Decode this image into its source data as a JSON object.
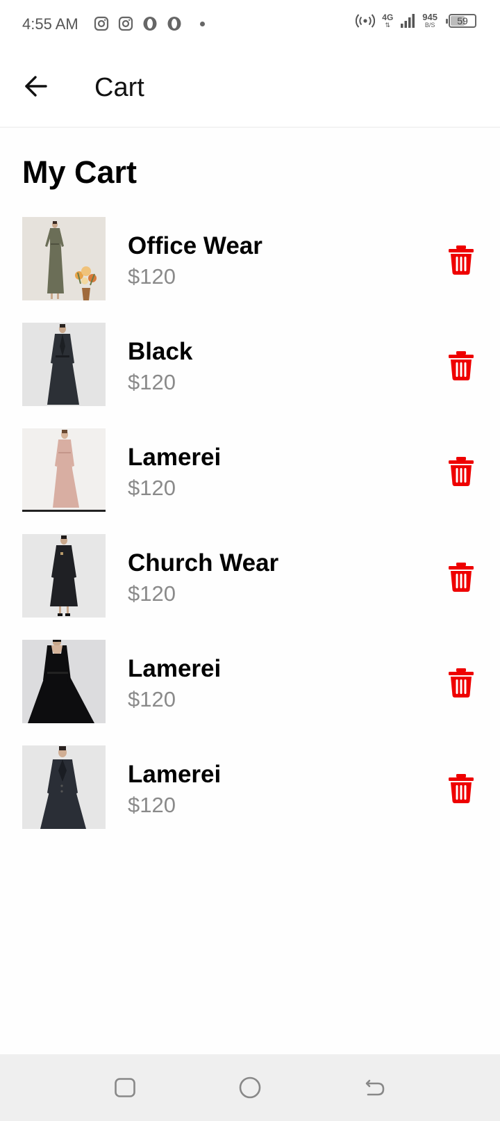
{
  "status_bar": {
    "time": "4:55 AM",
    "network_type": "4G",
    "network_sub": "⇅",
    "speed_value": "945",
    "speed_unit": "B/S",
    "battery_level": "59",
    "battery_fraction": 0.59,
    "icons": [
      "instagram-icon",
      "instagram-icon",
      "opera-icon",
      "opera-icon",
      "notification-dot-icon",
      "hotspot-icon",
      "signal-icon",
      "battery-icon"
    ]
  },
  "app_bar": {
    "back_icon": "arrow-left-icon",
    "title": "Cart"
  },
  "page": {
    "heading": "My Cart"
  },
  "cart": {
    "items": [
      {
        "name": "Office Wear",
        "price": "$120",
        "thumbnail": "olive-dress-photo"
      },
      {
        "name": "Black",
        "price": "$120",
        "thumbnail": "black-coat-dress-photo"
      },
      {
        "name": "Lamerei",
        "price": "$120",
        "thumbnail": "pink-dress-photo"
      },
      {
        "name": "Church Wear",
        "price": "$120",
        "thumbnail": "black-dress-photo"
      },
      {
        "name": "Lamerei",
        "price": "$120",
        "thumbnail": "black-square-neck-dress-photo"
      },
      {
        "name": "Lamerei",
        "price": "$120",
        "thumbnail": "dark-blazer-dress-photo"
      }
    ],
    "delete_icon": "trash-icon"
  },
  "nav_bar": {
    "buttons": [
      "recent-apps-icon",
      "home-icon",
      "back-nav-icon"
    ]
  },
  "colors": {
    "delete": "#ee0000",
    "price": "#8a8a8a",
    "nav_background": "#efefef"
  }
}
